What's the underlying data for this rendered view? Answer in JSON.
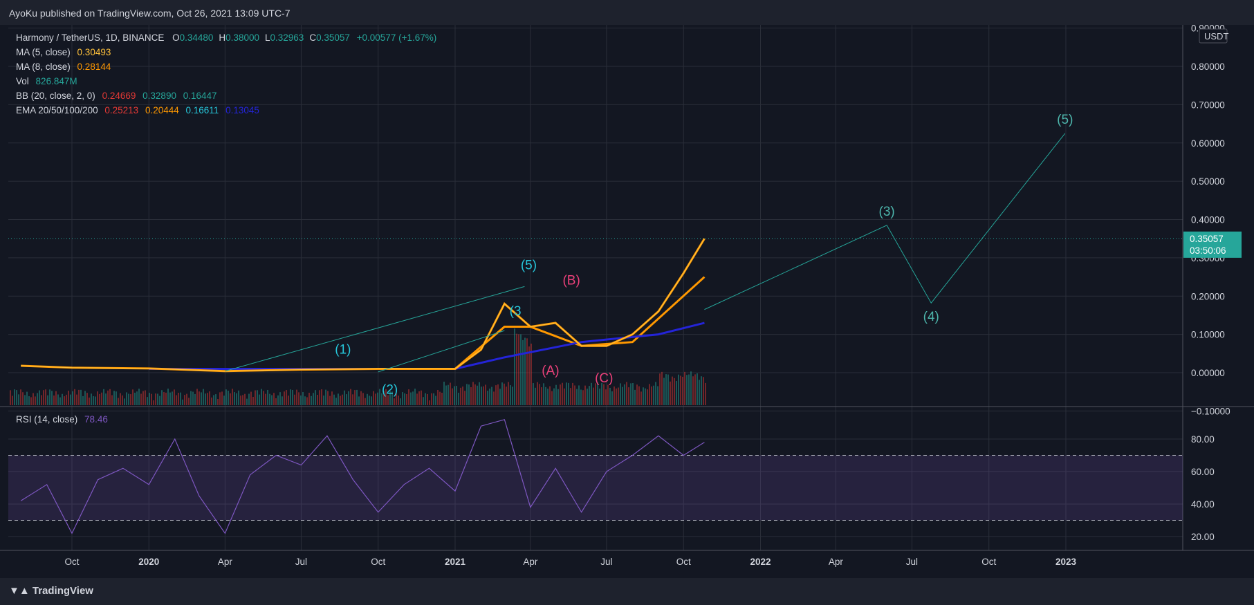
{
  "header": {
    "publisher": "AyoKu published on TradingView.com, Oct 26, 2021 13:09 UTC-7"
  },
  "footer": {
    "brand": "TradingView"
  },
  "legend": {
    "symbol": "Harmony / TetherUS, 1D, BINANCE",
    "ohlc": [
      {
        "k": "O",
        "v": "0.34480"
      },
      {
        "k": "H",
        "v": "0.38000"
      },
      {
        "k": "L",
        "v": "0.32963"
      },
      {
        "k": "C",
        "v": "0.35057"
      }
    ],
    "change": "+0.00577 (+1.67%)",
    "ma5": {
      "label": "MA (5, close)",
      "value": "0.30493"
    },
    "ma8": {
      "label": "MA (8, close)",
      "value": "0.28144"
    },
    "vol": {
      "label": "Vol",
      "value": "826.847M"
    },
    "bb": {
      "label": "BB (20, close, 2, 0)",
      "values": [
        "0.24669",
        "0.32890",
        "0.16447"
      ]
    },
    "ema": {
      "label": "EMA 20/50/100/200",
      "values": [
        "0.25213",
        "0.20444",
        "0.16611",
        "0.13045"
      ]
    },
    "rsi": {
      "label": "RSI (14, close)",
      "value": "78.46"
    }
  },
  "colors": {
    "bg": "#131722",
    "grid": "#2a2e39",
    "text": "#d1d4dc",
    "teal": "#26a69a",
    "cyan": "#26c6da",
    "pink": "#ec407a",
    "orange": "#ff9800",
    "yellow": "#ffc13b",
    "red": "#e53935",
    "blue": "#2424d8",
    "green_text": "#4db6ac",
    "purple": "#7e57c2",
    "price_tag": "#26a69a"
  },
  "chart_data": {
    "type": "line",
    "price_axis": {
      "unit": "USDT",
      "ticks": [
        "0.90000",
        "0.80000",
        "0.70000",
        "0.60000",
        "0.50000",
        "0.40000",
        "0.30000",
        "0.20000",
        "0.10000",
        "0.00000",
        "−0.10000"
      ],
      "ylim": [
        -0.15,
        0.9
      ],
      "last_price": "0.35057",
      "countdown": "03:50:06"
    },
    "time_axis": {
      "ticks": [
        "Oct",
        "2020",
        "Apr",
        "Jul",
        "Oct",
        "2021",
        "Apr",
        "Jul",
        "Oct",
        "2022",
        "Apr",
        "Jul",
        "Oct",
        "2023"
      ],
      "bold": [
        false,
        true,
        false,
        false,
        false,
        true,
        false,
        false,
        false,
        true,
        false,
        false,
        false,
        true
      ]
    },
    "price_series": {
      "name": "Close",
      "x": [
        "2019-08",
        "2019-10",
        "2020-01",
        "2020-04",
        "2020-07",
        "2020-10",
        "2021-01",
        "2021-02",
        "2021-03",
        "2021-04",
        "2021-05",
        "2021-06",
        "2021-07",
        "2021-08",
        "2021-09",
        "2021-10",
        "2021-10-26"
      ],
      "y": [
        0.018,
        0.013,
        0.011,
        0.004,
        0.008,
        0.01,
        0.01,
        0.06,
        0.18,
        0.12,
        0.13,
        0.07,
        0.07,
        0.1,
        0.16,
        0.26,
        0.35
      ]
    },
    "ema_series": [
      {
        "name": "EMA 20",
        "x": [
          "2021-01",
          "2021-03",
          "2021-04",
          "2021-06",
          "2021-08",
          "2021-10-26"
        ],
        "y": [
          0.01,
          0.12,
          0.12,
          0.07,
          0.08,
          0.25
        ]
      },
      {
        "name": "EMA 200",
        "x": [
          "2020-01",
          "2021-01",
          "2021-03",
          "2021-06",
          "2021-09",
          "2021-10-26"
        ],
        "y": [
          0.01,
          0.01,
          0.04,
          0.08,
          0.1,
          0.13
        ]
      }
    ],
    "wave_projection": {
      "x": [
        "2021-10-26",
        "2022-06-01",
        "2022-07-24",
        "2022-12-31"
      ],
      "y": [
        0.165,
        0.385,
        0.182,
        0.625
      ],
      "labels": [
        "(3)",
        "(4)",
        "(5)"
      ]
    },
    "wave_labels": [
      {
        "text": "(1)",
        "color": "cyan",
        "x": "2020-08-20",
        "y": 0.05
      },
      {
        "text": "(2)",
        "color": "cyan",
        "x": "2020-10-15",
        "y": -0.055
      },
      {
        "text": "(3",
        "color": "cyan",
        "x": "2021-03-14",
        "y": 0.15
      },
      {
        "text": "(5)",
        "color": "cyan",
        "x": "2021-03-30",
        "y": 0.27
      },
      {
        "text": "(B)",
        "color": "pink",
        "x": "2021-05-20",
        "y": 0.23
      },
      {
        "text": "(A)",
        "color": "pink",
        "x": "2021-04-25",
        "y": -0.005
      },
      {
        "text": "(C)",
        "color": "pink",
        "x": "2021-06-28",
        "y": -0.025
      }
    ],
    "rsi": {
      "name": "RSI (14, close)",
      "ylim": [
        10,
        95
      ],
      "ticks": [
        "80.00",
        "60.00",
        "40.00",
        "20.00"
      ],
      "bands": [
        30,
        70
      ],
      "x": [
        "2019-08",
        "2019-09",
        "2019-10",
        "2019-11",
        "2019-12",
        "2020-01",
        "2020-02",
        "2020-03",
        "2020-04",
        "2020-05",
        "2020-06",
        "2020-07",
        "2020-08",
        "2020-09",
        "2020-10",
        "2020-11",
        "2020-12",
        "2021-01",
        "2021-02",
        "2021-03",
        "2021-04",
        "2021-05",
        "2021-06",
        "2021-07",
        "2021-08",
        "2021-09",
        "2021-10",
        "2021-10-26"
      ],
      "y": [
        42,
        52,
        22,
        55,
        62,
        52,
        80,
        45,
        22,
        58,
        70,
        64,
        82,
        55,
        35,
        52,
        62,
        48,
        88,
        92,
        38,
        62,
        35,
        60,
        70,
        82,
        70,
        78
      ]
    }
  }
}
